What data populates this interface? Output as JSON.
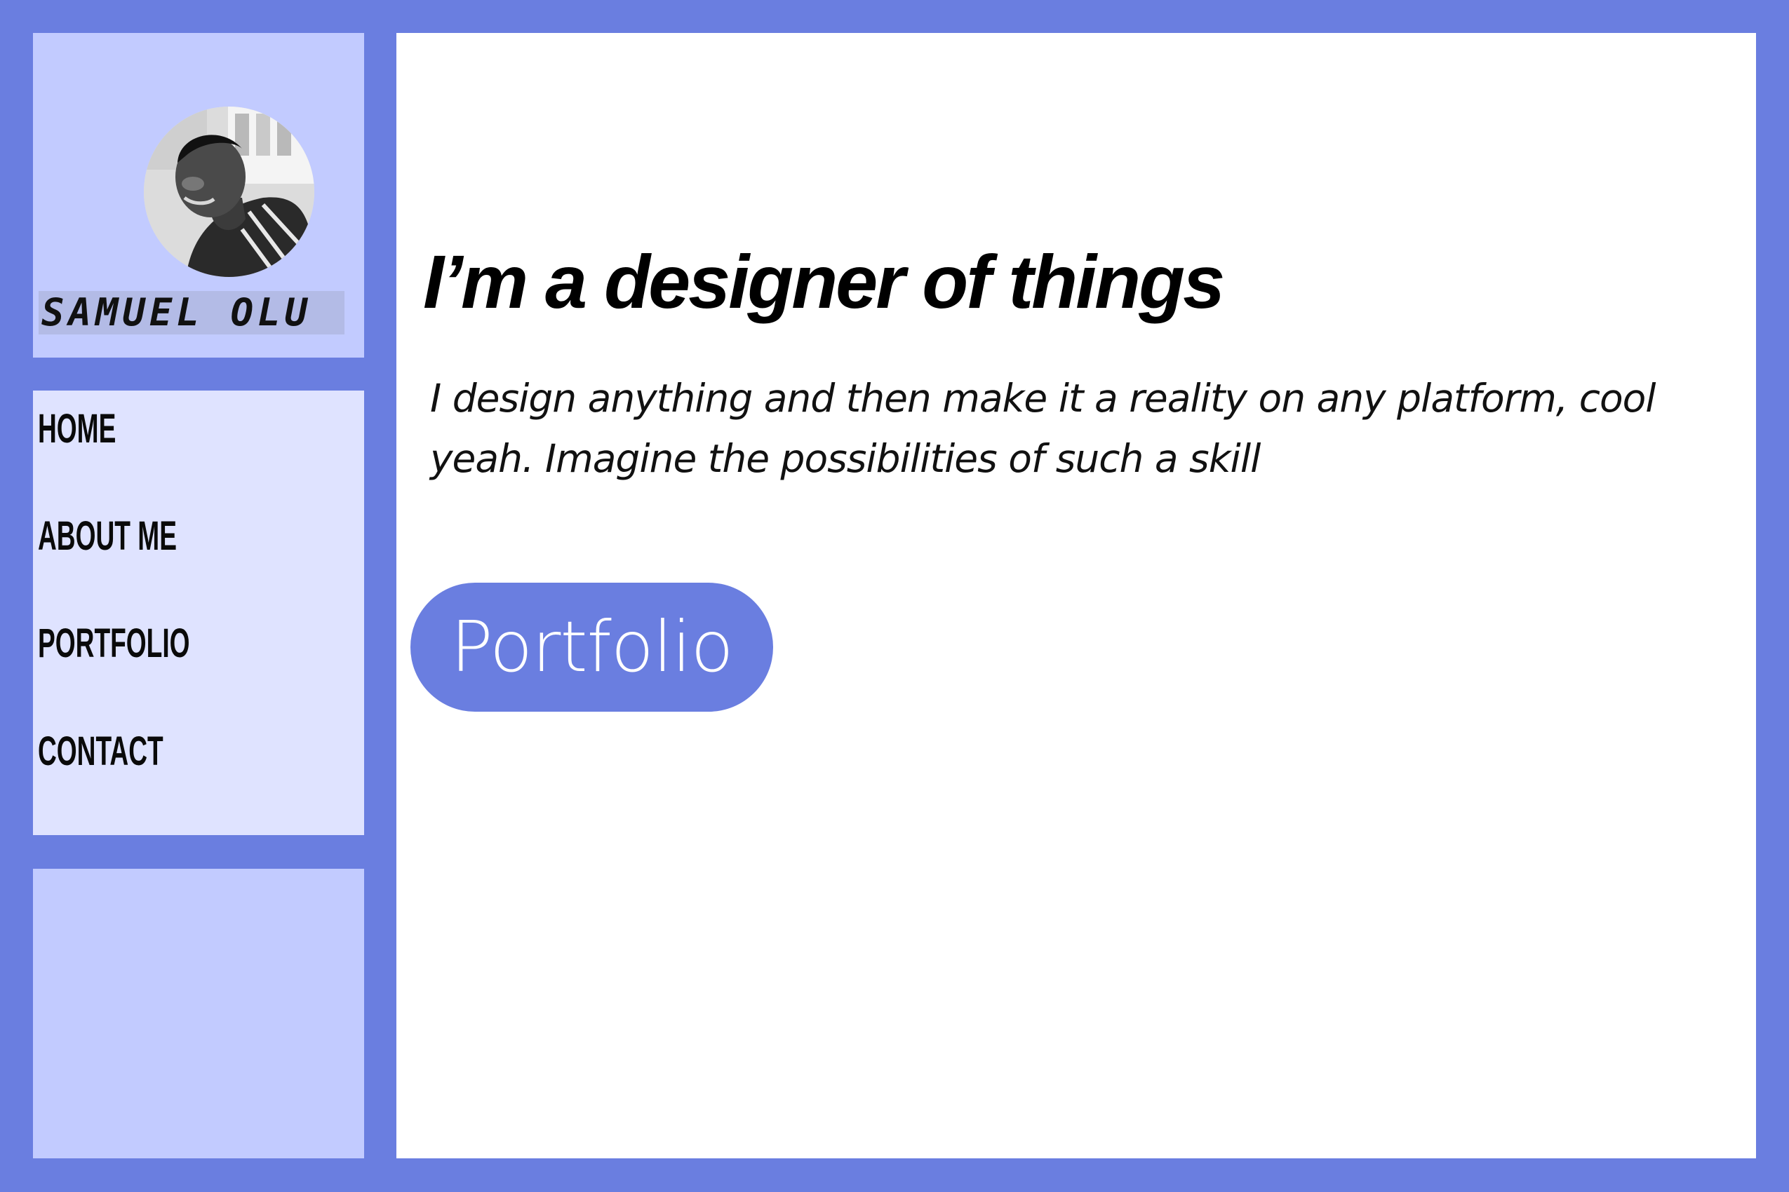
{
  "brand": {
    "name": "SAMUEL OLU",
    "avatar_alt": "profile photo"
  },
  "nav": {
    "items": [
      {
        "label": "HOME"
      },
      {
        "label": "ABOUT ME"
      },
      {
        "label": "PORTFOLIO"
      },
      {
        "label": "CONTACT"
      }
    ]
  },
  "hero": {
    "headline": "I’m a designer of things",
    "tagline": "I design anything and then make it a reality on any platform, cool yeah. Imagine the possibilities of such a skill",
    "button_label": "Portfolio"
  },
  "colors": {
    "background": "#6a7ee0",
    "panel_light": "#c2cbff",
    "nav_panel": "#dfe3ff",
    "accent": "#6a7ee0"
  }
}
